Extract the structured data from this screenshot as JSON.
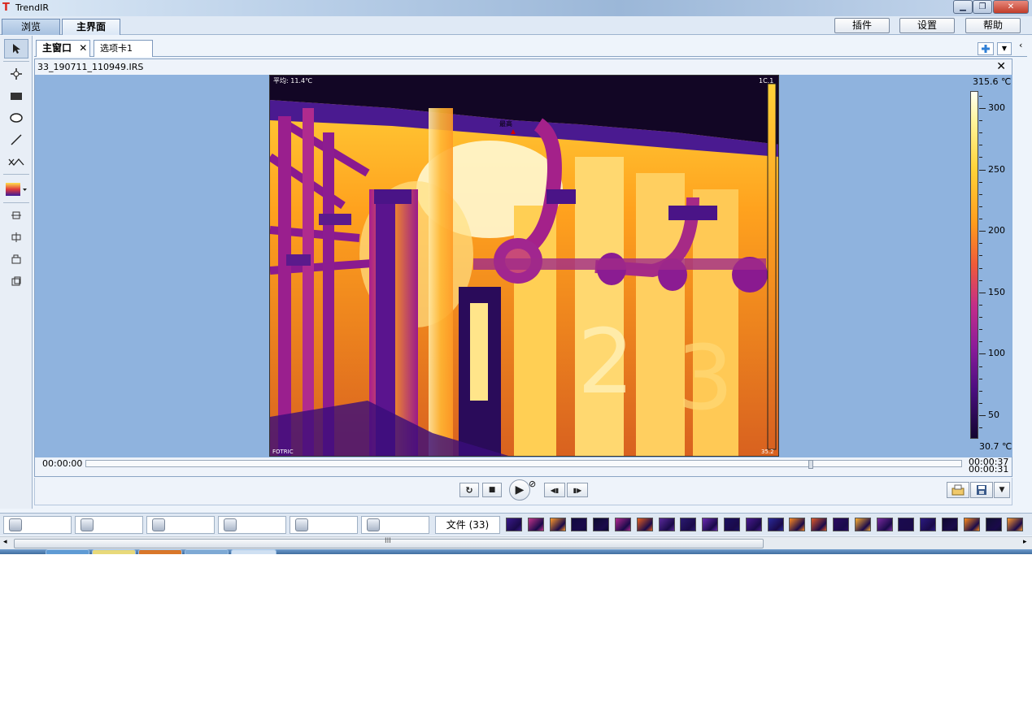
{
  "window": {
    "title": "TrendIR",
    "logo": "T"
  },
  "top_tabs": [
    {
      "label": "浏览"
    },
    {
      "label": "主界面"
    }
  ],
  "top_buttons": {
    "plugin": "插件",
    "settings": "设置",
    "help": "帮助"
  },
  "left_toolbar": [
    "pointer-icon",
    "point-icon",
    "rectangle-icon",
    "ellipse-icon",
    "line-icon",
    "polyline-icon",
    "palette-icon",
    "align-top-icon",
    "align-middle-icon",
    "align-left-icon",
    "align-right-icon"
  ],
  "doc_tabs": [
    {
      "label": "主窗口",
      "close": "✕"
    },
    {
      "label": "选项卡1"
    }
  ],
  "viewer": {
    "filename": "33_190711_110949.IRS",
    "close": "✕",
    "overlay": {
      "top_left": "平均: 11.4℃",
      "top_right": "1C.1",
      "bottom_left": "FOTRIC",
      "bottom_right": "35.2",
      "marker": "最高"
    }
  },
  "color_scale": {
    "max": "315.6 ℃",
    "min": "30.7 ℃",
    "ticks": [
      "300",
      "250",
      "200",
      "150",
      "100",
      "50"
    ]
  },
  "timeline": {
    "start": "00:00:00",
    "end1": "00:00:37",
    "end2": "00:00:31",
    "position": 0.83
  },
  "player": {
    "replay": "↻",
    "stop": "■",
    "play": "▶",
    "loop": "⊘",
    "prev": "◀▮",
    "next": "▮▶"
  },
  "bottom_strip": {
    "cameras": [
      "camera-1",
      "camera-2",
      "camera-3",
      "camera-4",
      "camera-5",
      "camera-6"
    ],
    "file_count": "文件 (33)"
  },
  "scroll_mark": "III",
  "colors": {
    "viewer_bg": "#8fb3de",
    "accent": "#3a78c8",
    "close_red": "#c13c2a"
  }
}
